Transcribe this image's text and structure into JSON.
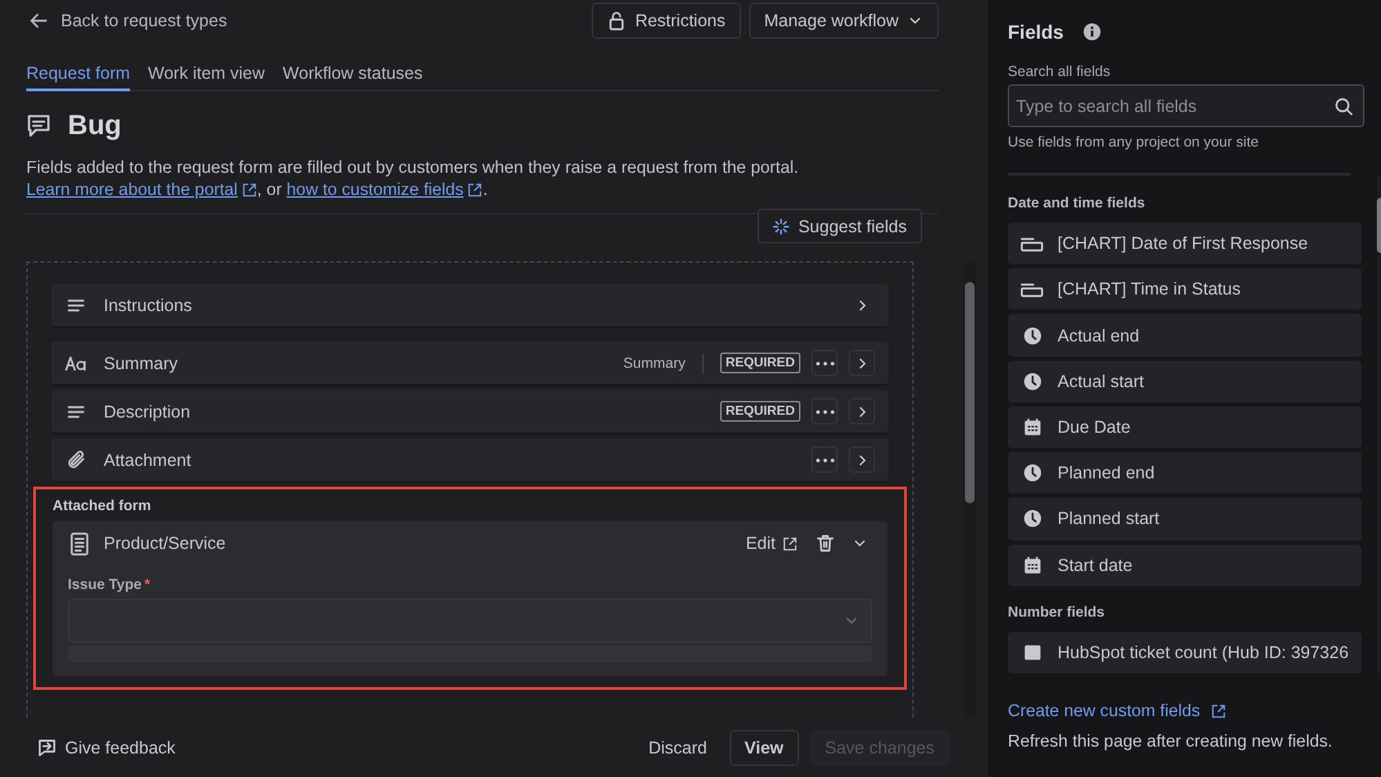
{
  "header": {
    "back_link": "Back to request types",
    "restrictions_button": "Restrictions",
    "manage_workflow_button": "Manage workflow"
  },
  "tabs": [
    {
      "label": "Request form",
      "selected": true
    },
    {
      "label": "Work item view",
      "selected": false
    },
    {
      "label": "Workflow statuses",
      "selected": false
    }
  ],
  "title": "Bug",
  "description": [
    {
      "kind": "text",
      "text": "Fields added to the request form are filled out by customers when they raise a request from the portal. "
    },
    {
      "kind": "link",
      "text": "Learn more about the portal"
    },
    {
      "kind": "text",
      "text": ", or "
    },
    {
      "kind": "link",
      "text": "how to customize fields"
    },
    {
      "kind": "text",
      "text": "."
    }
  ],
  "suggest_button": "Suggest fields",
  "fields": [
    {
      "kind": "paragraph",
      "label": "Instructions",
      "menu": false,
      "required": false
    },
    {
      "kind": "text",
      "label": "Summary",
      "type_label": "Summary",
      "menu": true,
      "required": true,
      "required_label": "REQUIRED"
    },
    {
      "kind": "paragraph",
      "label": "Description",
      "menu": true,
      "required": true,
      "required_label": "REQUIRED"
    },
    {
      "kind": "attachment",
      "label": "Attachment",
      "menu": true,
      "required": false
    }
  ],
  "attached_form": {
    "heading": "Attached form",
    "highlighted": true,
    "name": "Product/Service",
    "edit_button": "Edit",
    "expanded": true,
    "fields": [
      {
        "label": "Issue Type",
        "required": true,
        "required_mark": "*"
      }
    ]
  },
  "footer": {
    "feedback_button": "Give feedback",
    "discard_button": "Discard",
    "view_button": "View",
    "save_button": {
      "label": "Save changes",
      "disabled": true
    }
  },
  "sidebar": {
    "title": "Fields",
    "search": {
      "label": "Search all fields",
      "placeholder": "Type to search all fields"
    },
    "hint": "Use fields from any project on your site",
    "groups": [
      {
        "heading": "Date and time fields",
        "items": [
          {
            "kind": "chart",
            "label": "[CHART] Date of First Response"
          },
          {
            "kind": "chart",
            "label": "[CHART] Time in Status"
          },
          {
            "kind": "time",
            "label": "Actual end"
          },
          {
            "kind": "time",
            "label": "Actual start"
          },
          {
            "kind": "date",
            "label": "Due Date"
          },
          {
            "kind": "time",
            "label": "Planned end"
          },
          {
            "kind": "time",
            "label": "Planned start"
          },
          {
            "kind": "date",
            "label": "Start date"
          }
        ]
      },
      {
        "heading": "Number fields",
        "items": [
          {
            "kind": "number",
            "label": "HubSpot ticket count (Hub ID: 397326"
          }
        ]
      }
    ],
    "create_link": "Create new custom fields",
    "refresh_note": "Refresh this page after creating new fields."
  }
}
